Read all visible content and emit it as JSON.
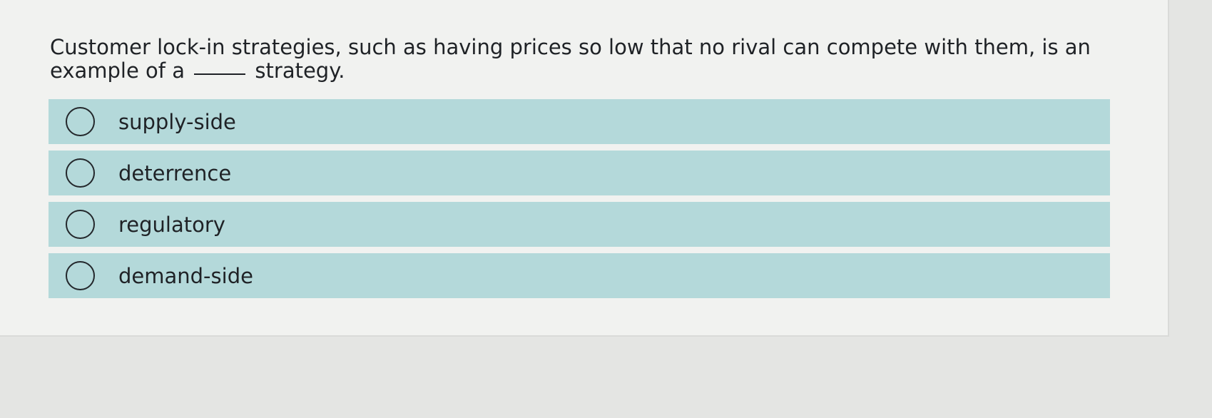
{
  "question": {
    "text_before": "Customer lock-in strategies, such as having prices so low that no rival can compete with them, is an example of a",
    "text_after": "strategy."
  },
  "options": [
    {
      "label": "supply-side"
    },
    {
      "label": "deterrence"
    },
    {
      "label": "regulatory"
    },
    {
      "label": "demand-side"
    }
  ],
  "colors": {
    "option_bg": "#b4d9da",
    "page_bg": "#f1f2f0",
    "text": "#1f2226"
  }
}
